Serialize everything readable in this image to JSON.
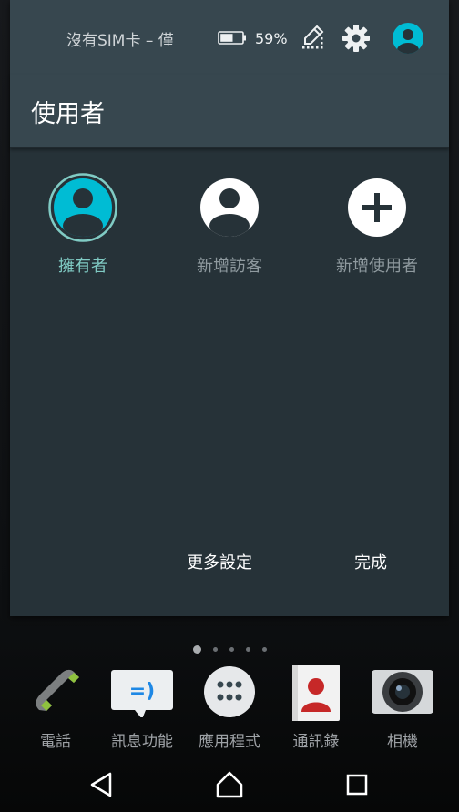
{
  "status_bar": {
    "carrier_text": "沒有SIM卡 – 僅",
    "battery_percent": "59%",
    "battery_level": 0.59
  },
  "panel": {
    "title": "使用者",
    "users": [
      {
        "label": "擁有者",
        "icon": "owner-avatar-icon",
        "active": true
      },
      {
        "label": "新增訪客",
        "icon": "guest-avatar-icon",
        "active": false
      },
      {
        "label": "新增使用者",
        "icon": "add-icon",
        "active": false
      }
    ],
    "more_settings_label": "更多設定",
    "done_label": "完成"
  },
  "home": {
    "page_count": 5,
    "active_page": 1,
    "dock": [
      {
        "label": "電話",
        "icon": "phone-icon"
      },
      {
        "label": "訊息功能",
        "icon": "messaging-icon"
      },
      {
        "label": "應用程式",
        "icon": "apps-icon"
      },
      {
        "label": "通訊錄",
        "icon": "contacts-icon"
      },
      {
        "label": "相機",
        "icon": "camera-icon"
      }
    ]
  },
  "navbar": {
    "icons": [
      "back-icon",
      "home-icon",
      "recents-icon"
    ]
  },
  "colors": {
    "accent": "#00bcd4",
    "accent_light": "#80cbc4",
    "panel_bg": "#263238",
    "header_bg": "#37474f"
  }
}
